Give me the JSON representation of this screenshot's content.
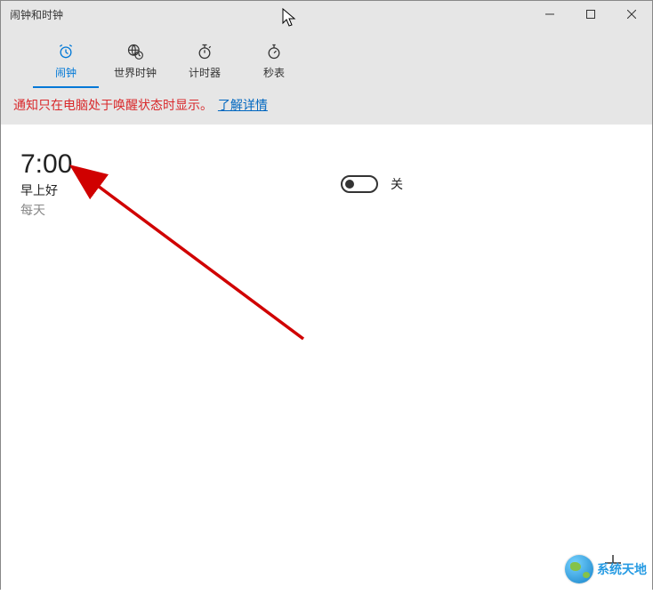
{
  "window": {
    "title": "闹钟和时钟"
  },
  "tabs": {
    "alarm": {
      "label": "闹钟"
    },
    "world_clock": {
      "label": "世界时钟"
    },
    "timer": {
      "label": "计时器"
    },
    "stopwatch": {
      "label": "秒表"
    }
  },
  "notice": {
    "text": "通知只在电脑处于唤醒状态时显示。",
    "link": "了解详情"
  },
  "alarm": {
    "time": "7:00",
    "name": "早上好",
    "repeat": "每天",
    "state_label": "关"
  },
  "watermark": {
    "text": "系统天地"
  }
}
